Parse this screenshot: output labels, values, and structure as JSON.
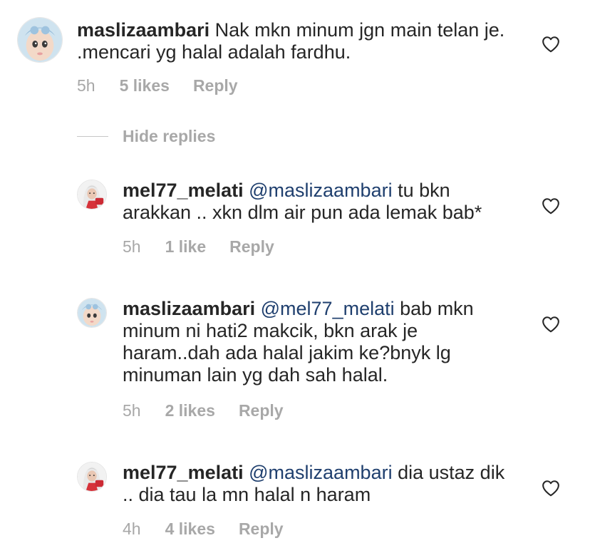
{
  "comments": [
    {
      "username": "maslizaambari",
      "mention": "",
      "text": "Nak mkn minum jgn main telan je. .mencari yg halal adalah fardhu.",
      "time": "5h",
      "likes": "5 likes",
      "reply": "Reply"
    },
    {
      "username": "mel77_melati",
      "mention": "@maslizaambari",
      "text": "tu bkn arakkan .. xkn dlm air pun ada lemak bab*",
      "time": "5h",
      "likes": "1 like",
      "reply": "Reply"
    },
    {
      "username": "maslizaambari",
      "mention": "@mel77_melati",
      "text": "bab mkn minum ni hati2 makcik, bkn arak je haram..dah ada halal jakim ke?bnyk lg minuman lain yg dah sah halal.",
      "time": "5h",
      "likes": "2 likes",
      "reply": "Reply"
    },
    {
      "username": "mel77_melati",
      "mention": "@maslizaambari",
      "text": "dia ustaz dik .. dia tau la mn halal n haram",
      "time": "4h",
      "likes": "4 likes",
      "reply": "Reply"
    }
  ],
  "thread": {
    "hide_replies_label": "Hide replies"
  },
  "icons": {
    "like": "heart-outline-icon",
    "avatar_baby": "baby-avatar",
    "avatar_woman": "woman-hijab-avatar"
  },
  "colors": {
    "text": "#262626",
    "secondary": "#a8a8a8",
    "mention": "#1f3f6e"
  }
}
